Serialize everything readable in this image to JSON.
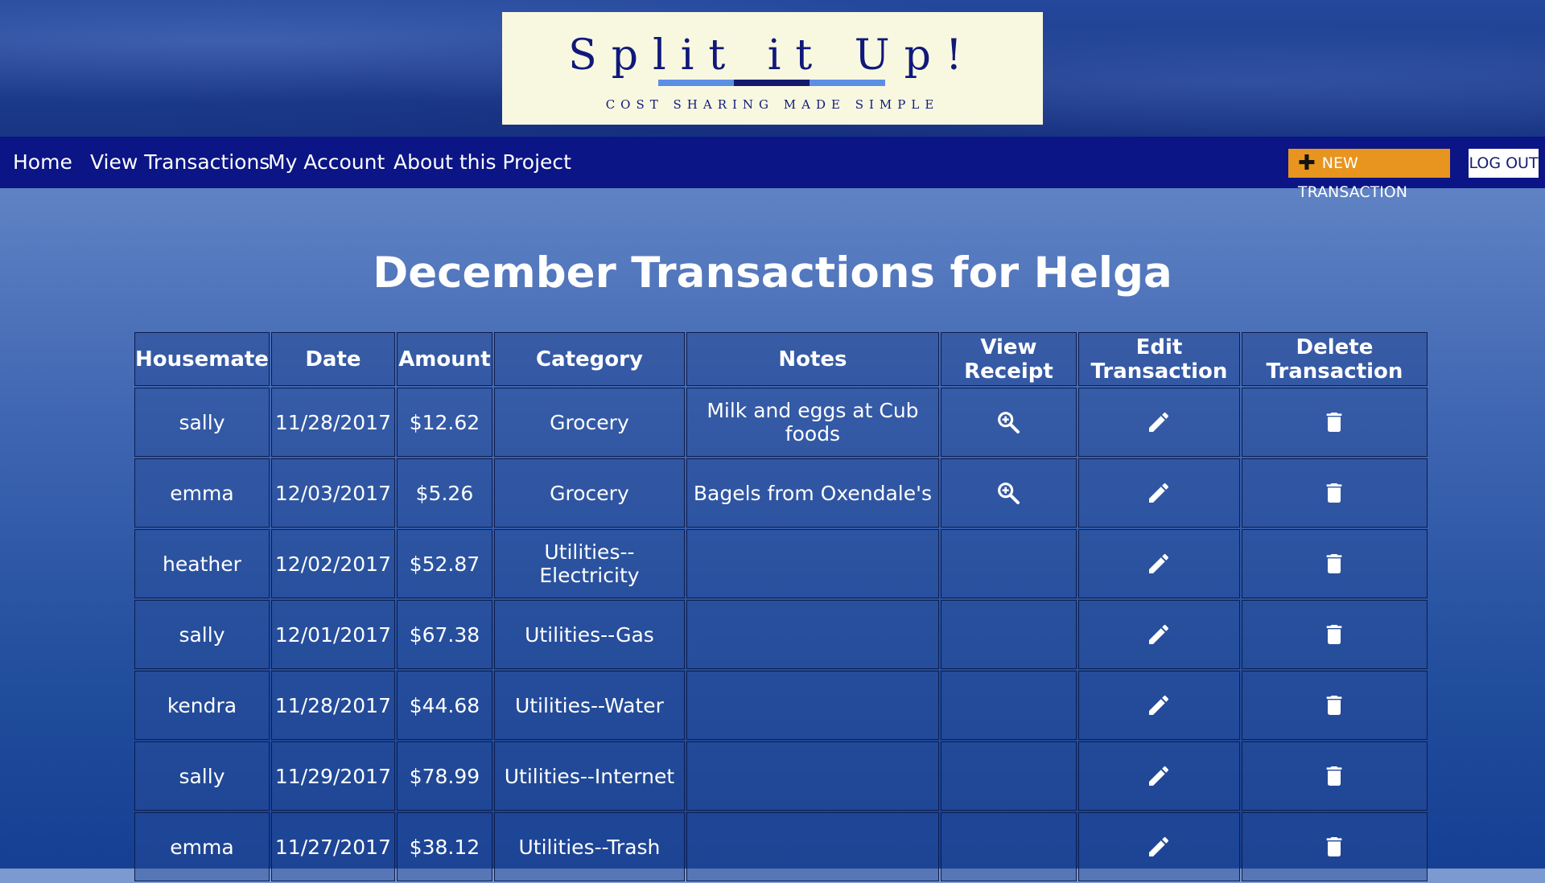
{
  "logo": {
    "title": "Split it Up!",
    "tagline": "COST SHARING MADE SIMPLE"
  },
  "nav": {
    "links": [
      "Home",
      "View Transactions",
      "My Account",
      "About this Project"
    ],
    "new_transaction_label": "NEW TRANSACTION",
    "logout_label": "LOG OUT"
  },
  "page": {
    "title": "December Transactions for Helga"
  },
  "table": {
    "headers": [
      "Housemate",
      "Date",
      "Amount",
      "Category",
      "Notes",
      "View Receipt",
      "Edit Transaction",
      "Delete Transaction"
    ],
    "rows": [
      {
        "housemate": "sally",
        "date": "11/28/2017",
        "amount": "$12.62",
        "category": "Grocery",
        "notes": "Milk and eggs at Cub foods",
        "has_receipt": true
      },
      {
        "housemate": "emma",
        "date": "12/03/2017",
        "amount": "$5.26",
        "category": "Grocery",
        "notes": "Bagels from Oxendale's",
        "has_receipt": true
      },
      {
        "housemate": "heather",
        "date": "12/02/2017",
        "amount": "$52.87",
        "category": "Utilities--Electricity",
        "notes": "",
        "has_receipt": false
      },
      {
        "housemate": "sally",
        "date": "12/01/2017",
        "amount": "$67.38",
        "category": "Utilities--Gas",
        "notes": "",
        "has_receipt": false
      },
      {
        "housemate": "kendra",
        "date": "11/28/2017",
        "amount": "$44.68",
        "category": "Utilities--Water",
        "notes": "",
        "has_receipt": false
      },
      {
        "housemate": "sally",
        "date": "11/29/2017",
        "amount": "$78.99",
        "category": "Utilities--Internet",
        "notes": "",
        "has_receipt": false
      },
      {
        "housemate": "emma",
        "date": "11/27/2017",
        "amount": "$38.12",
        "category": "Utilities--Trash",
        "notes": "",
        "has_receipt": false
      }
    ]
  },
  "icons": {
    "view_receipt": "zoom-in-icon",
    "edit": "pencil-icon",
    "delete": "trash-icon",
    "new": "plus-icon"
  },
  "colors": {
    "navbar": "#0b1585",
    "new_button": "#e8951f",
    "logo_bg": "#f8f8e0",
    "logo_text": "#10197a"
  }
}
